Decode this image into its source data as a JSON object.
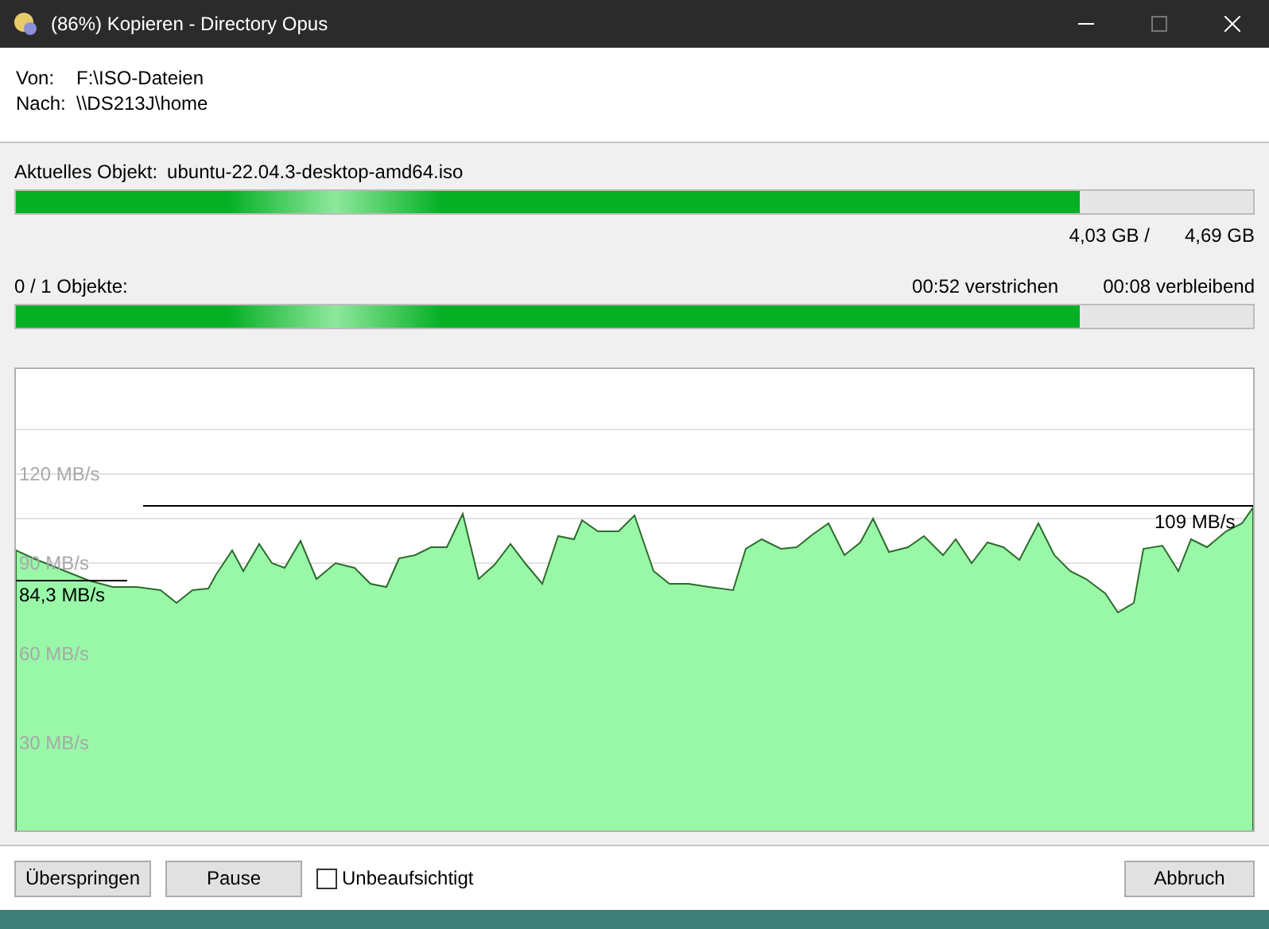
{
  "window": {
    "title": "(86%) Kopieren - Directory Opus"
  },
  "header": {
    "from_label": "Von:",
    "from": "F:\\ISO-Dateien",
    "to_label": "Nach:",
    "to": "\\\\DS213J\\home"
  },
  "current": {
    "label": "Aktuelles Objekt:",
    "name": "ubuntu-22.04.3-desktop-amd64.iso",
    "level": 0.86,
    "done": "4,03 GB /",
    "total": "4,69 GB"
  },
  "overall": {
    "count": "0 / 1 Objekte:",
    "elapsed": "00:52 verstrichen",
    "remaining": "00:08 verbleibend",
    "level": 0.86
  },
  "graph": {
    "axis_labels": [
      "120 MB/s",
      "90 MB/s",
      "60 MB/s",
      "30 MB/s"
    ],
    "markers": [
      {
        "text": "84,3 MB/s"
      },
      {
        "text": "109 MB/s"
      }
    ]
  },
  "buttons": {
    "skip": "Überspringen",
    "pause": "Pause",
    "cancel": "Abbruch"
  },
  "unattended": {
    "label": "Unbeaufsichtigt",
    "checked": false
  }
}
